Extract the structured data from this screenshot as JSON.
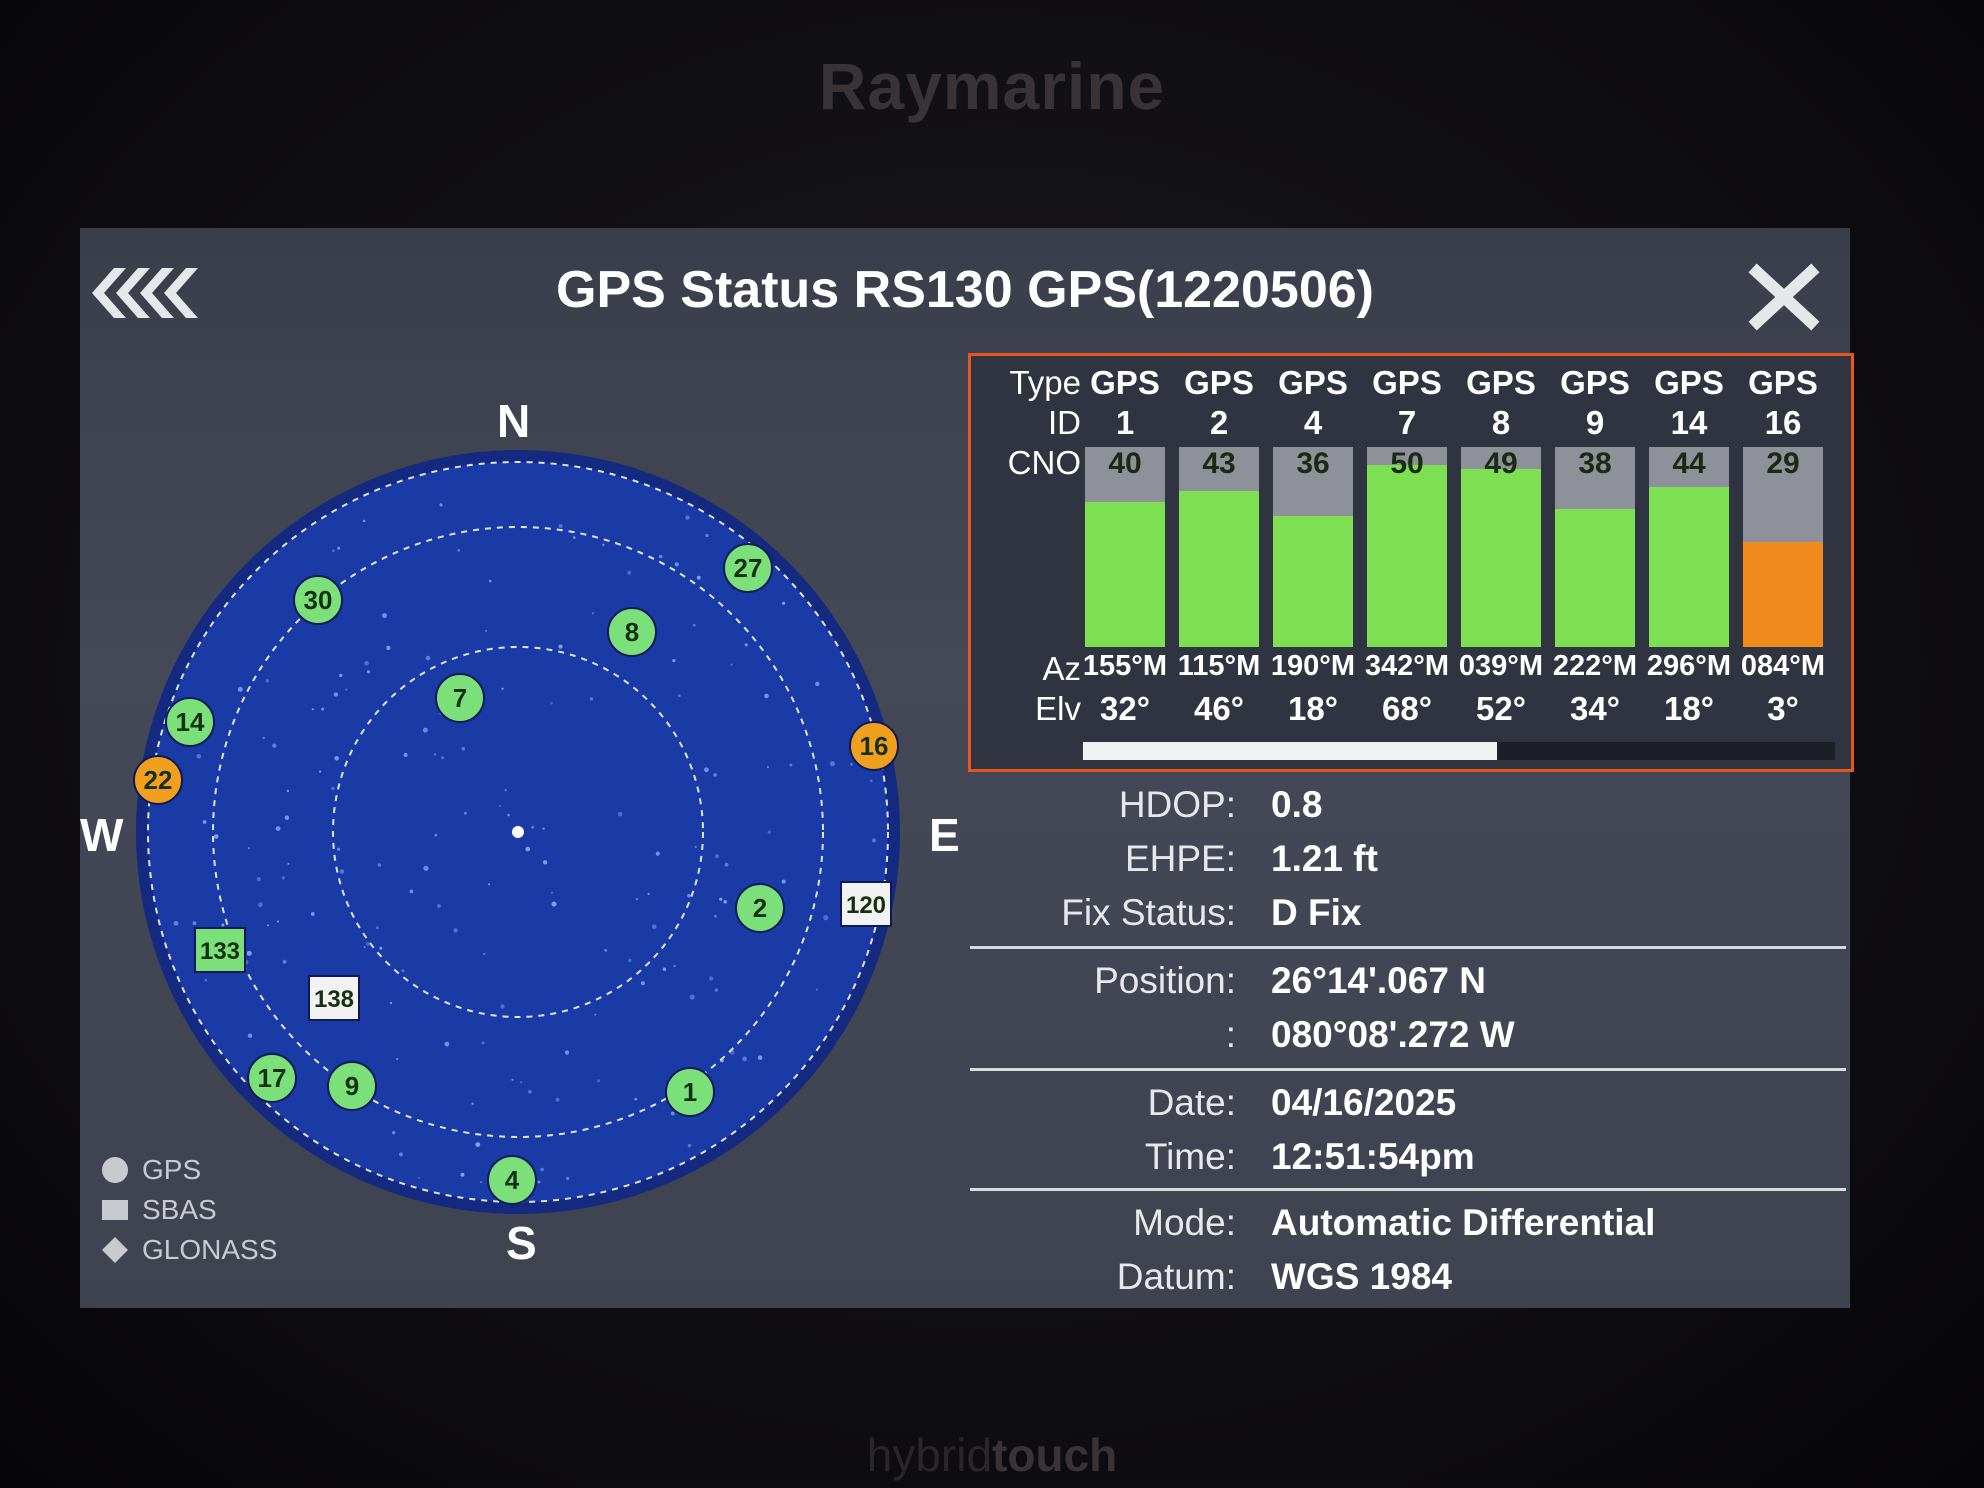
{
  "device": {
    "brand": "Raymarine",
    "footer_light": "hybrid",
    "footer_bold": "touch"
  },
  "header": {
    "title": "GPS Status RS130 GPS(1220506)",
    "back_icon": "back-chevrons-icon",
    "close_icon": "close-icon"
  },
  "skyview": {
    "compass": {
      "n": "N",
      "s": "S",
      "e": "E",
      "w": "W"
    },
    "satellites": [
      {
        "id": "27",
        "status": "green",
        "kind": "GPS"
      },
      {
        "id": "30",
        "status": "green",
        "kind": "GPS"
      },
      {
        "id": "8",
        "status": "green",
        "kind": "GPS"
      },
      {
        "id": "7",
        "status": "green",
        "kind": "GPS"
      },
      {
        "id": "14",
        "status": "green",
        "kind": "GPS"
      },
      {
        "id": "22",
        "status": "orange",
        "kind": "GPS"
      },
      {
        "id": "16",
        "status": "orange",
        "kind": "GPS"
      },
      {
        "id": "2",
        "status": "green",
        "kind": "GPS"
      },
      {
        "id": "120",
        "status": "white",
        "kind": "SBAS"
      },
      {
        "id": "133",
        "status": "green",
        "kind": "SBAS"
      },
      {
        "id": "138",
        "status": "white",
        "kind": "SBAS"
      },
      {
        "id": "17",
        "status": "green",
        "kind": "GPS"
      },
      {
        "id": "9",
        "status": "green",
        "kind": "GPS"
      },
      {
        "id": "1",
        "status": "green",
        "kind": "GPS"
      },
      {
        "id": "4",
        "status": "green",
        "kind": "GPS"
      }
    ],
    "legend": [
      {
        "label": "GPS",
        "shape": "circle"
      },
      {
        "label": "SBAS",
        "shape": "square"
      },
      {
        "label": "GLONASS",
        "shape": "diamond"
      }
    ]
  },
  "signal_table": {
    "labels": {
      "type": "Type",
      "id": "ID",
      "cno": "CNO",
      "az": "Az",
      "elv": "Elv"
    },
    "max_cno": 55,
    "colors": {
      "strong": "#7de052",
      "weak": "#f08a1c",
      "background": "#8e9199"
    },
    "columns": [
      {
        "type": "GPS",
        "id": "1",
        "cno": "40",
        "cno_value": 40,
        "status": "strong",
        "az": "155°M",
        "elv": "32°"
      },
      {
        "type": "GPS",
        "id": "2",
        "cno": "43",
        "cno_value": 43,
        "status": "strong",
        "az": "115°M",
        "elv": "46°"
      },
      {
        "type": "GPS",
        "id": "4",
        "cno": "36",
        "cno_value": 36,
        "status": "strong",
        "az": "190°M",
        "elv": "18°"
      },
      {
        "type": "GPS",
        "id": "7",
        "cno": "50",
        "cno_value": 50,
        "status": "strong",
        "az": "342°M",
        "elv": "68°"
      },
      {
        "type": "GPS",
        "id": "8",
        "cno": "49",
        "cno_value": 49,
        "status": "strong",
        "az": "039°M",
        "elv": "52°"
      },
      {
        "type": "GPS",
        "id": "9",
        "cno": "38",
        "cno_value": 38,
        "status": "strong",
        "az": "222°M",
        "elv": "34°"
      },
      {
        "type": "GPS",
        "id": "14",
        "cno": "44",
        "cno_value": 44,
        "status": "strong",
        "az": "296°M",
        "elv": "18°"
      },
      {
        "type": "GPS",
        "id": "16",
        "cno": "29",
        "cno_value": 29,
        "status": "weak",
        "az": "084°M",
        "elv": "3°"
      }
    ],
    "scroll_visible_fraction": 0.55
  },
  "status": {
    "hdop": {
      "label": "HDOP:",
      "value": "0.8"
    },
    "ehpe": {
      "label": "EHPE:",
      "value": "1.21 ft"
    },
    "fix": {
      "label": "Fix Status:",
      "value": "D Fix"
    },
    "position": {
      "label": "Position:",
      "lat": "26°14'.067 N",
      "lon_label": ":",
      "lon": "080°08'.272 W"
    },
    "date": {
      "label": "Date:",
      "value": "04/16/2025"
    },
    "time": {
      "label": "Time:",
      "value": "12:51:54pm"
    },
    "mode": {
      "label": "Mode:",
      "value": "Automatic Differential"
    },
    "datum": {
      "label": "Datum:",
      "value": "WGS 1984"
    }
  }
}
